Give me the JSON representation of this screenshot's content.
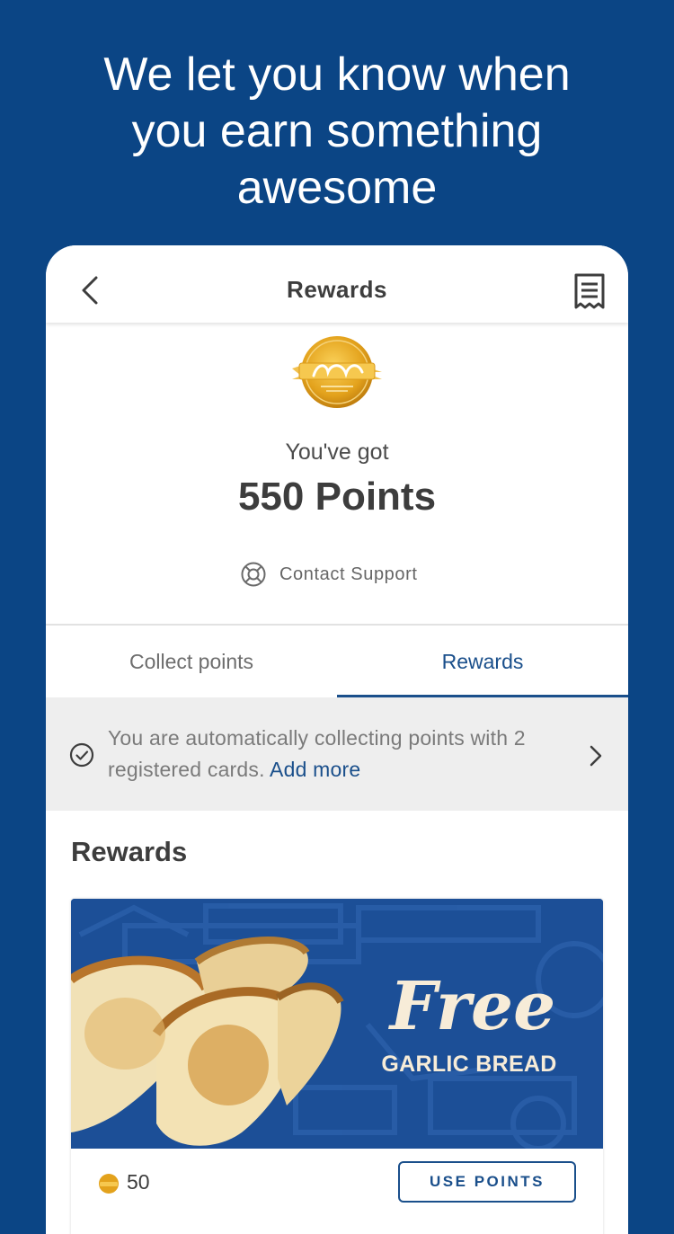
{
  "headline": {
    "line1": "We let you know when",
    "line2": "you earn something",
    "line3": "awesome"
  },
  "navbar": {
    "title": "Rewards",
    "back_icon": "chevron-left-icon",
    "receipt_icon": "receipt-icon"
  },
  "balance": {
    "label": "You've got",
    "points": "550 Points"
  },
  "support": {
    "label": "Contact Support",
    "icon": "lifebuoy-icon"
  },
  "tabs": [
    {
      "label": "Collect points",
      "active": false
    },
    {
      "label": "Rewards",
      "active": true
    }
  ],
  "banner": {
    "text": "You are automatically collecting points with 2 registered cards.",
    "link": "Add more",
    "icon": "check-circle-icon"
  },
  "rewards_section": {
    "title": "Rewards"
  },
  "reward_card": {
    "promo_line1": "Free",
    "promo_line2": "GARLIC BREAD",
    "cost": "50",
    "button": "USE POINTS"
  },
  "colors": {
    "background": "#0b4585",
    "accent": "#1a4f8b",
    "promo_bg": "#1c4f97",
    "promo_text": "#f7ecd8"
  }
}
